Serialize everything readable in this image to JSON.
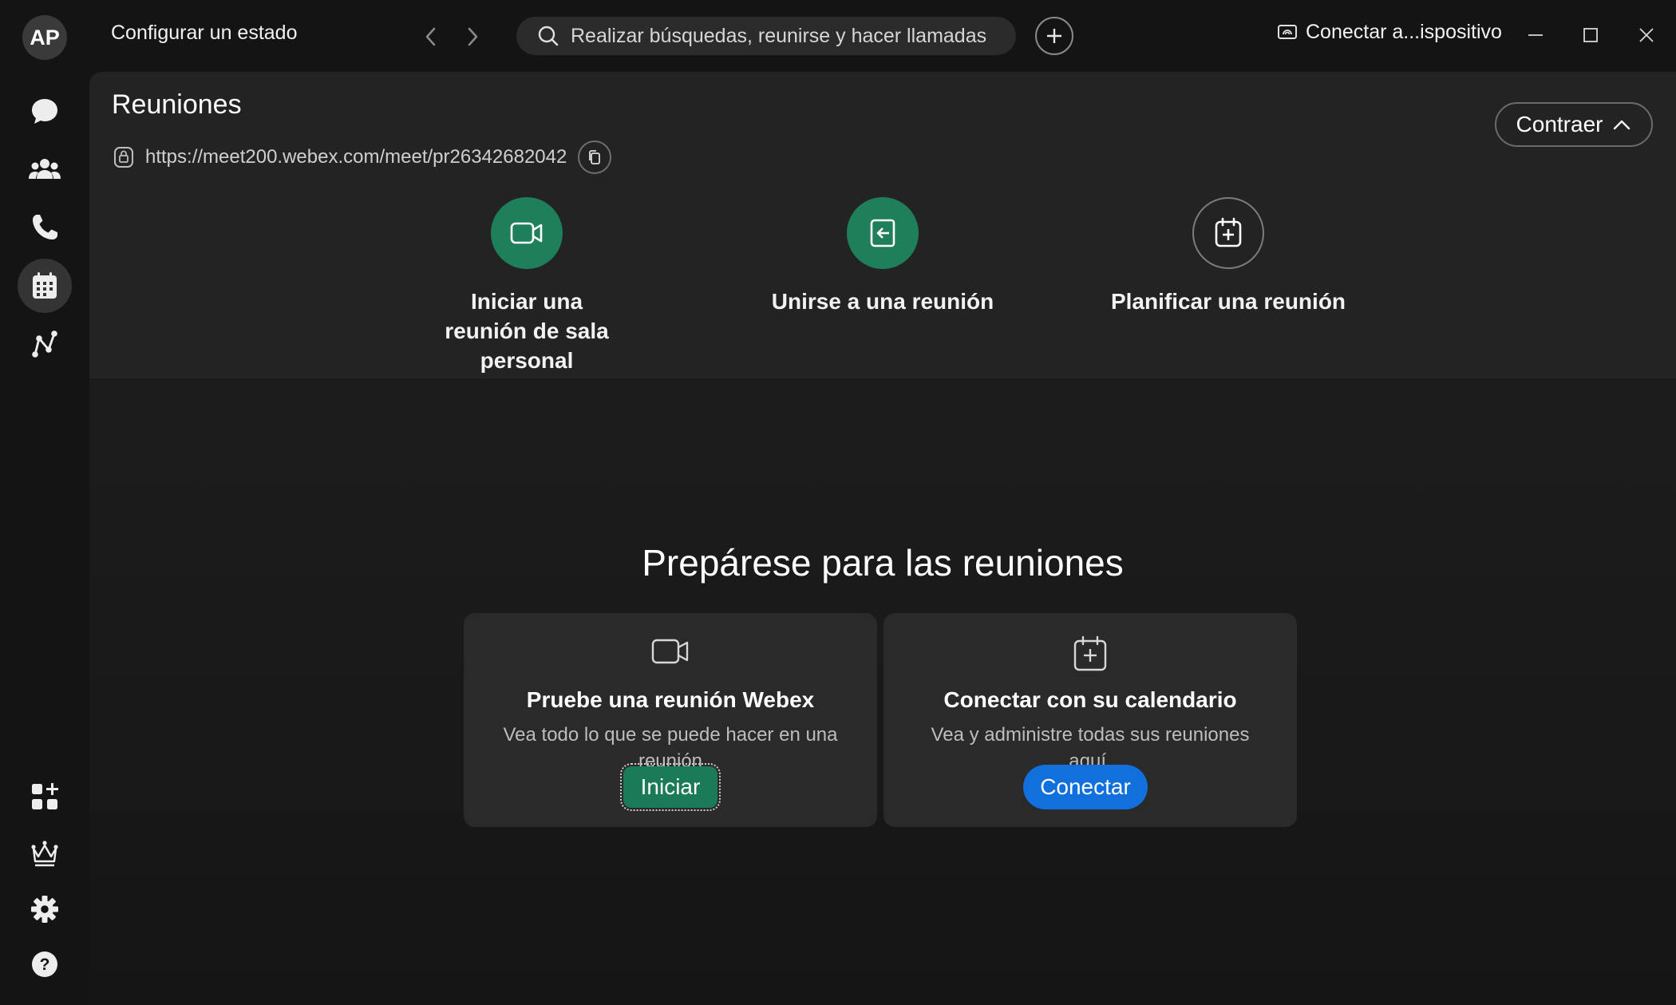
{
  "window": {
    "avatar_initials": "AP",
    "status_link": "Configurar un estado",
    "search_placeholder": "Realizar búsquedas, reunirse y hacer llamadas",
    "device_label": "Conectar a...ispositivo"
  },
  "sidebar": {
    "items": [
      {
        "icon": "message-icon",
        "label": "Mensajes"
      },
      {
        "icon": "teams-icon",
        "label": "Equipos"
      },
      {
        "icon": "phone-icon",
        "label": "Llamadas"
      },
      {
        "icon": "calendar-icon",
        "label": "Reuniones",
        "active": true
      },
      {
        "icon": "workflow-icon",
        "label": "Flujos"
      }
    ],
    "bottom_items": [
      {
        "icon": "apps-icon"
      },
      {
        "icon": "crown-icon"
      },
      {
        "icon": "gear-icon"
      },
      {
        "icon": "help-icon"
      }
    ]
  },
  "meetings": {
    "title": "Reuniones",
    "personal_room_url": "https://meet200.webex.com/meet/pr26342682042",
    "collapse_label": "Contraer",
    "actions": [
      {
        "label": "Iniciar una reunión de sala personal",
        "icon": "video-icon",
        "style": "green"
      },
      {
        "label": "Unirse a una reunión",
        "icon": "join-icon",
        "style": "green"
      },
      {
        "label": "Planificar una reunión",
        "icon": "calendar-add-icon",
        "style": "outline"
      }
    ]
  },
  "prepare": {
    "title": "Prepárese para las reuniones",
    "cards": [
      {
        "icon": "video-icon",
        "title": "Pruebe una reunión Webex",
        "description": "Vea todo lo que se puede hacer en una reunión",
        "button": "Iniciar"
      },
      {
        "icon": "calendar-add-icon",
        "title": "Conectar con su calendario",
        "description": "Vea y administre todas sus reuniones aquí.",
        "button": "Conectar"
      }
    ]
  },
  "colors": {
    "accent_green": "#1f7f5a",
    "accent_blue": "#1270dd",
    "background": "#141414"
  }
}
